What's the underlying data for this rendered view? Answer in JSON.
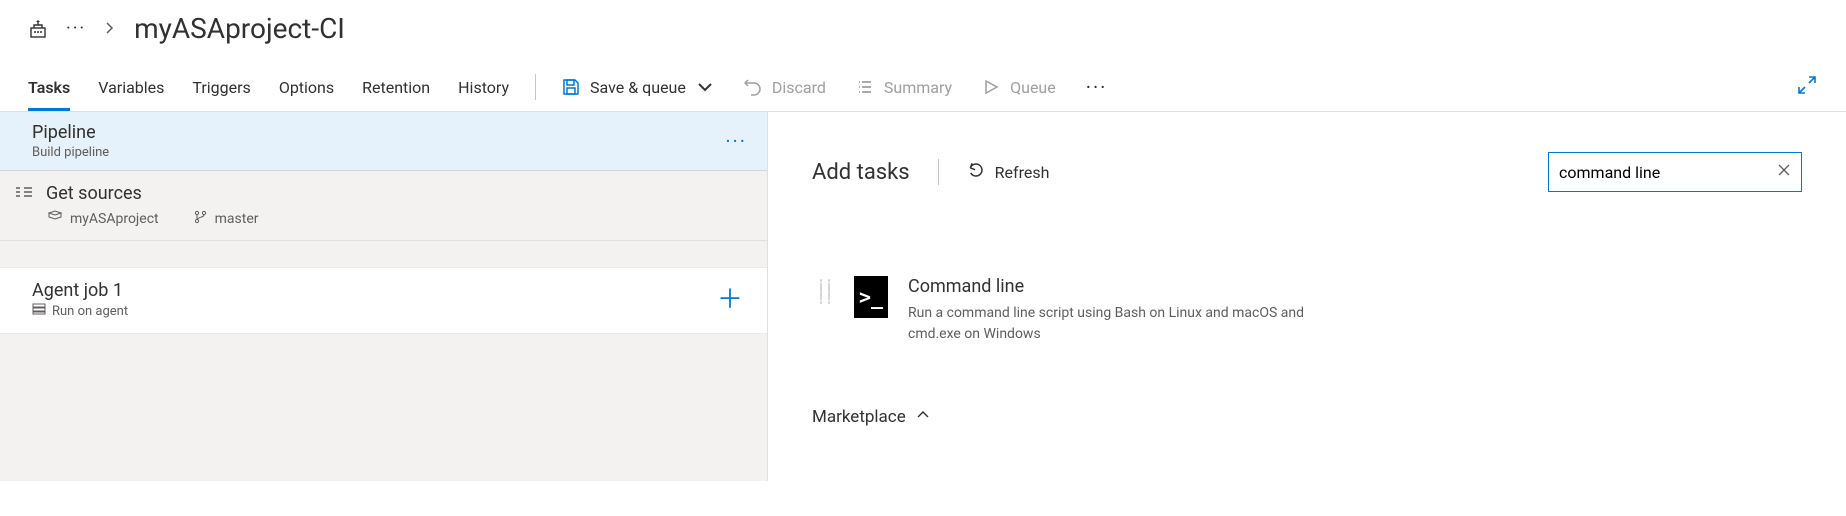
{
  "breadcrumb": {
    "title": "myASAproject-CI"
  },
  "tabs": [
    "Tasks",
    "Variables",
    "Triggers",
    "Options",
    "Retention",
    "History"
  ],
  "active_tab": 0,
  "toolbar": {
    "save_queue": "Save & queue",
    "discard": "Discard",
    "summary": "Summary",
    "queue": "Queue"
  },
  "pipeline": {
    "title": "Pipeline",
    "subtitle": "Build pipeline"
  },
  "sources": {
    "title": "Get sources",
    "repo": "myASAproject",
    "branch": "master"
  },
  "agent_job": {
    "title": "Agent job 1",
    "subtitle": "Run on agent"
  },
  "add_tasks": {
    "heading": "Add tasks",
    "refresh": "Refresh",
    "search_value": "command line"
  },
  "task_result": {
    "name": "Command line",
    "desc": "Run a command line script using Bash on Linux and macOS and cmd.exe on Windows",
    "glyph": ">_"
  },
  "marketplace_label": "Marketplace"
}
